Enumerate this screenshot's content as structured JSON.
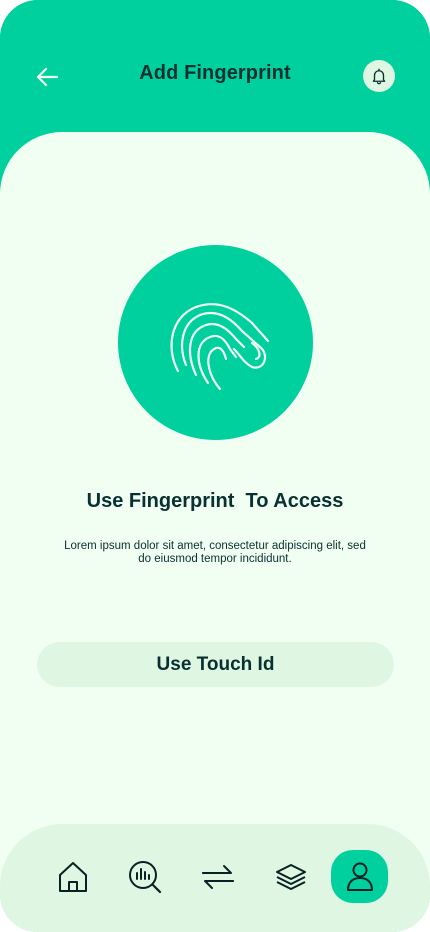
{
  "header": {
    "title": "Add Fingerprint",
    "back_icon": "arrow-left-icon",
    "notification_icon": "bell-icon"
  },
  "main": {
    "fingerprint_icon": "fingerprint-icon",
    "headline": "Use Fingerprint  To Access",
    "description": "Lorem ipsum dolor sit amet, consectetur adipiscing elit, sed do eiusmod tempor incididunt.",
    "touch_button_label": "Use Touch Id"
  },
  "bottom_nav": {
    "items": [
      {
        "icon": "home-icon",
        "active": false
      },
      {
        "icon": "analysis-icon",
        "active": false
      },
      {
        "icon": "transactions-icon",
        "active": false
      },
      {
        "icon": "layers-icon",
        "active": false
      },
      {
        "icon": "profile-icon",
        "active": true
      }
    ]
  },
  "colors": {
    "primary": "#00D09E",
    "background": "#F1FFF3",
    "light_green": "#DFF7E2",
    "dark_text": "#093030"
  }
}
